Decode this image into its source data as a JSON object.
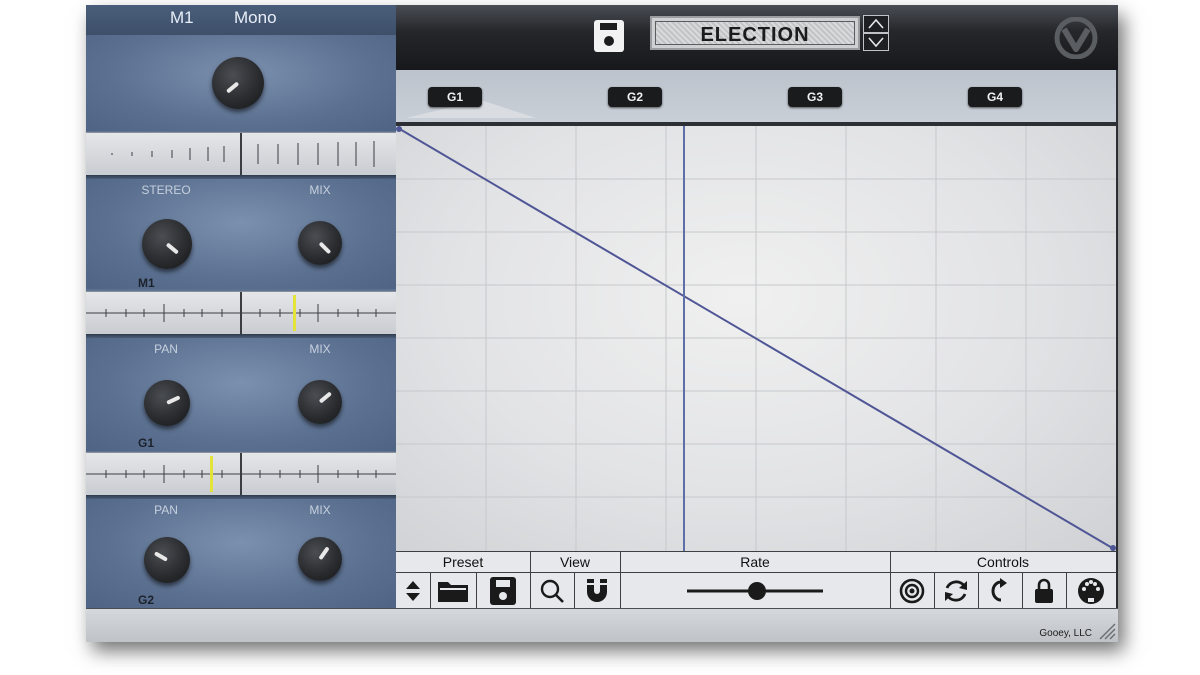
{
  "left_panel": {
    "header": {
      "slot": "M1",
      "mode": "Mono"
    },
    "sections": [
      {
        "knob1_label": "STEREO",
        "knob2_label": "MIX",
        "target": "M1"
      },
      {
        "knob1_label": "PAN",
        "knob2_label": "MIX",
        "target": "G1"
      },
      {
        "knob1_label": "PAN",
        "knob2_label": "MIX",
        "target": "G2"
      }
    ]
  },
  "header": {
    "preset_name": "ELECTION",
    "save_icon": "floppy-icon",
    "logo_icon": "gooey-logo-icon"
  },
  "tabs": [
    {
      "label": "G1",
      "active": true
    },
    {
      "label": "G2",
      "active": false
    },
    {
      "label": "G3",
      "active": false
    },
    {
      "label": "G4",
      "active": false
    }
  ],
  "toolbar": {
    "groups": [
      {
        "label": "Preset",
        "buttons": [
          "up-down-arrows-icon",
          "folder-icon",
          "save-icon"
        ]
      },
      {
        "label": "View",
        "buttons": [
          "zoom-icon",
          "magnet-icon"
        ]
      },
      {
        "label": "Rate",
        "buttons": [
          "rate-slider"
        ]
      },
      {
        "label": "Controls",
        "buttons": [
          "target-icon",
          "loop-icon",
          "return-icon",
          "lock-icon",
          "midi-icon"
        ]
      }
    ]
  },
  "footer": {
    "copyright": "Gooey, LLC"
  },
  "colors": {
    "panel": "#5d7292",
    "curve": "#4f5696",
    "accent": "#e3e33a"
  }
}
